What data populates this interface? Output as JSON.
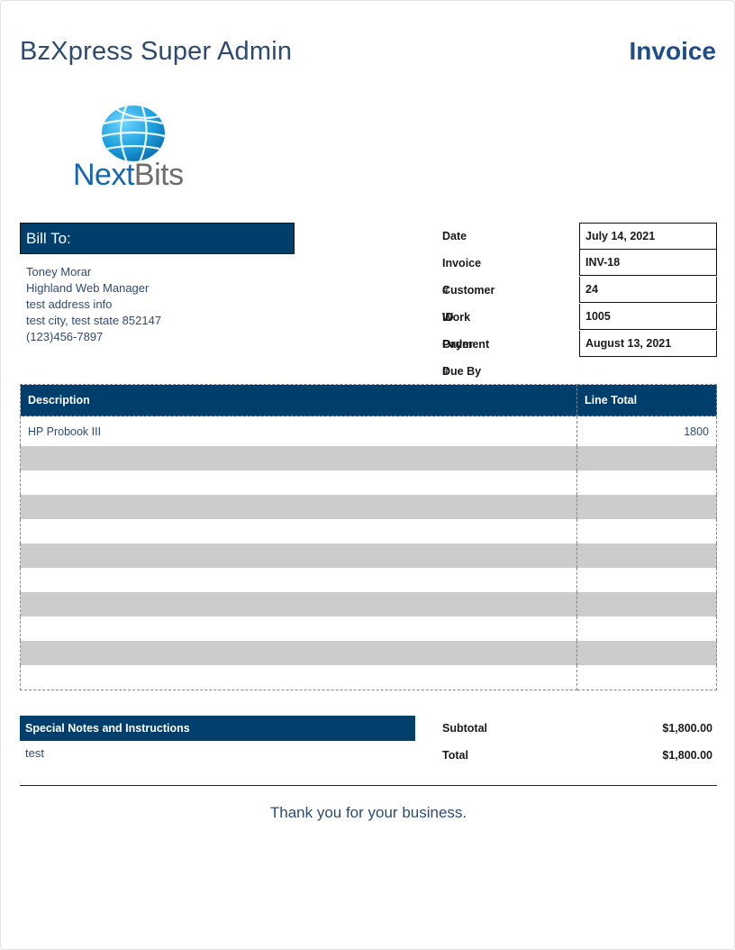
{
  "header": {
    "company_name": "BzXpress Super Admin",
    "document_title": "Invoice"
  },
  "logo": {
    "word_part1": "Next",
    "word_part2": "Bits",
    "globe_icon": "globe-icon",
    "colors": {
      "primary": "#1565b0",
      "secondary": "#6d6d6d",
      "globe": "#1ea0de"
    }
  },
  "bill_to": {
    "heading": "Bill To:",
    "name": "Toney Morar",
    "title": "Highland Web Manager",
    "address": "test address info",
    "city_line": "test city, test state 852147",
    "phone": "(123)456-7897"
  },
  "meta": [
    {
      "label": "Date",
      "value": "July 14, 2021"
    },
    {
      "label": "Invoice #",
      "value": "INV-18"
    },
    {
      "label": "Customer ID",
      "value": "24"
    },
    {
      "label": "Work Order #",
      "value": "1005"
    },
    {
      "label": "Payment Due By",
      "value": "August 13, 2021"
    }
  ],
  "items": {
    "headers": {
      "description": "Description",
      "line_total": "Line Total"
    },
    "rows": [
      {
        "description": "HP Probook III",
        "line_total": "1800"
      },
      {
        "description": "",
        "line_total": ""
      },
      {
        "description": "",
        "line_total": ""
      },
      {
        "description": "",
        "line_total": ""
      },
      {
        "description": "",
        "line_total": ""
      },
      {
        "description": "",
        "line_total": ""
      },
      {
        "description": "",
        "line_total": ""
      },
      {
        "description": "",
        "line_total": ""
      },
      {
        "description": "",
        "line_total": ""
      },
      {
        "description": "",
        "line_total": ""
      },
      {
        "description": "",
        "line_total": ""
      }
    ]
  },
  "notes": {
    "heading": "Special Notes and Instructions",
    "text": "test"
  },
  "totals": {
    "subtotal_label": "Subtotal",
    "subtotal_value": "$1,800.00",
    "total_label": "Total",
    "total_value": "$1,800.00"
  },
  "footer": {
    "thanks": "Thank you for your business."
  },
  "colors": {
    "header_bg": "#003f6b",
    "row_shade": "#cccccc",
    "text": "#2e4b73"
  }
}
